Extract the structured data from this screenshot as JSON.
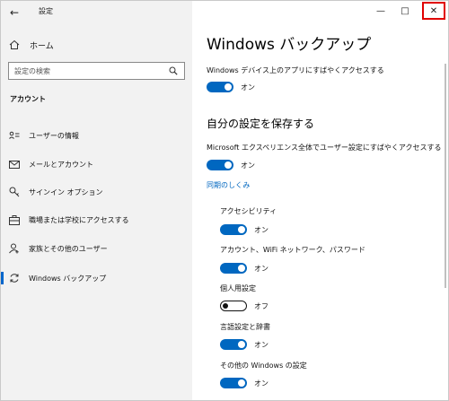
{
  "window": {
    "title": "設定",
    "back_icon": "arrow-left-icon",
    "controls": {
      "minimize": "—",
      "maximize": "□",
      "close": "✕"
    }
  },
  "sidebar": {
    "home": {
      "label": "ホーム",
      "icon": "home-icon"
    },
    "search": {
      "placeholder": "設定の検索",
      "icon": "search-icon"
    },
    "section_title": "アカウント",
    "items": [
      {
        "label": "ユーザーの情報",
        "icon": "user-card-icon"
      },
      {
        "label": "メールとアカウント",
        "icon": "mail-icon"
      },
      {
        "label": "サインイン オプション",
        "icon": "key-icon"
      },
      {
        "label": "職場または学校にアクセスする",
        "icon": "briefcase-icon"
      },
      {
        "label": "家族とその他のユーザー",
        "icon": "person-add-icon"
      },
      {
        "label": "Windows バックアップ",
        "icon": "sync-icon",
        "selected": true
      }
    ]
  },
  "main": {
    "page_title": "Windows バックアップ",
    "apps_backup": {
      "label": "Windows デバイス上のアプリにすばやくアクセスする",
      "state": "オン",
      "on": true
    },
    "section_title": "自分の設定を保存する",
    "settings_sync": {
      "label": "Microsoft エクスペリエンス全体でユーザー設定にすばやくアクセスする",
      "state": "オン",
      "on": true
    },
    "link": "同期のしくみ",
    "sub_settings": [
      {
        "label": "アクセシビリティ",
        "state": "オン",
        "on": true
      },
      {
        "label": "アカウント、WiFi ネットワーク、パスワード",
        "state": "オン",
        "on": true
      },
      {
        "label": "個人用設定",
        "state": "オフ",
        "on": false
      },
      {
        "label": "言語設定と辞書",
        "state": "オン",
        "on": true
      },
      {
        "label": "その他の Windows の設定",
        "state": "オン",
        "on": true
      }
    ]
  },
  "colors": {
    "accent": "#0067c0",
    "highlight_box": "#e00000",
    "sidebar_bg": "#f2f2f2"
  }
}
